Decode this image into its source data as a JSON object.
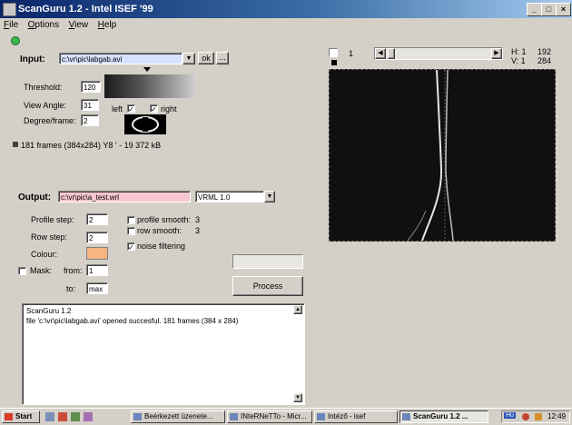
{
  "window": {
    "title": "ScanGuru 1.2  -  Intel ISEF '99"
  },
  "menu": [
    "File",
    "Options",
    "View",
    "Help"
  ],
  "input": {
    "label": "Input:",
    "path": "c:\\vr\\pic\\labgab.avi",
    "ok_label": "ok",
    "browse_label": "...",
    "threshold_label": "Threshold:",
    "threshold": "120",
    "view_angle_label": "View Angle:",
    "view_angle": "31",
    "left_label": "left",
    "right_label": "right",
    "left_checked": "✓",
    "right_checked": "✓",
    "degree_label": "Degree/frame:",
    "degree": "2",
    "info": "181 frames (384x284) Y8  ' - 19 372 kB"
  },
  "preview": {
    "frame_value": "1",
    "h_label": "H: 1",
    "h_value": "192",
    "v_label": "V: 1",
    "v_value": "284"
  },
  "output": {
    "label": "Output:",
    "path": "c:\\vr\\pic\\a_test.wrl",
    "format": "VRML 1.0",
    "profile_step_label": "Profile step:",
    "profile_step": "2",
    "row_step_label": "Row step:",
    "row_step": "2",
    "colour_label": "Colour:",
    "colour": "#f4b583",
    "profile_smooth_label": "profile smooth:",
    "profile_smooth": "3",
    "row_smooth_label": "row smooth:",
    "row_smooth": "3",
    "noise_label": "noise filtering",
    "noise_checked": "✓",
    "mask_label": "Mask:",
    "from_label": "from:",
    "from_value": "1",
    "to_label": "to:",
    "to_value": "max",
    "process_label": "Process"
  },
  "log": {
    "line1": "ScanGuru 1.2",
    "line2": "file 'c:\\vr\\pic\\labgab.avi' opened succesful. 181 frames (384 x 284)"
  },
  "taskbar": {
    "start": "Start",
    "items": [
      "Beérkezett üzenete...",
      "INteRNeTTo - Micr...",
      "Intéző - isef",
      "ScanGuru 1.2 ..."
    ],
    "tray_lang": "Hu",
    "clock": "12:49"
  },
  "colors": {
    "title_start": "#0a246a",
    "title_end": "#a6caf0",
    "output_field": "#f7c6d0",
    "preview_bg": "#111111"
  }
}
